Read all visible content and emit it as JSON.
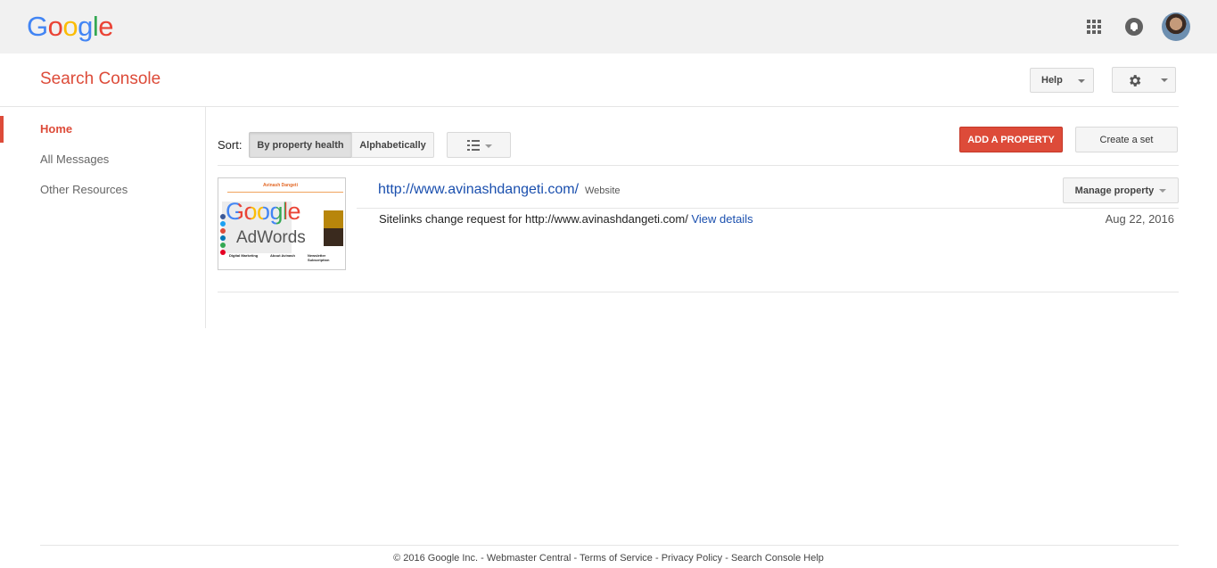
{
  "topbar": {
    "logo_letters": [
      {
        "ch": "G",
        "color": "#4285f4"
      },
      {
        "ch": "o",
        "color": "#ea4335"
      },
      {
        "ch": "o",
        "color": "#fbbc05"
      },
      {
        "ch": "g",
        "color": "#4285f4"
      },
      {
        "ch": "l",
        "color": "#34a853"
      },
      {
        "ch": "e",
        "color": "#ea4335"
      }
    ],
    "icons": [
      "apps-grid-icon",
      "notifications-bell-icon",
      "account-avatar"
    ]
  },
  "header": {
    "title": "Search Console",
    "help_label": "Help",
    "settings_icon": "gear-icon"
  },
  "sidebar": {
    "items": [
      {
        "label": "Home",
        "active": true
      },
      {
        "label": "All Messages",
        "active": false
      },
      {
        "label": "Other Resources",
        "active": false
      }
    ]
  },
  "toolbar": {
    "sort_label": "Sort:",
    "sort_options": [
      "By property health",
      "Alphabetically"
    ],
    "sort_selected": "By property health",
    "view_icon": "list-view-icon",
    "add_property_label": "ADD A PROPERTY",
    "create_set_label": "Create a set"
  },
  "property": {
    "url": "http://www.avinashdangeti.com/",
    "type": "Website",
    "manage_label": "Manage property",
    "thumbnail": {
      "header_text": "Avinash Dangeti",
      "google_text": "Google",
      "adwords_text": "AdWords",
      "footer_items": [
        "Digital Marketing",
        "About Avinash",
        "Newsletter Subscription"
      ]
    },
    "message": {
      "text": "Sitelinks change request for http://www.avinashdangeti.com/",
      "link_label": "View details",
      "date": "Aug 22, 2016"
    }
  },
  "footer": {
    "copyright": "© 2016 Google Inc.",
    "separator": " - ",
    "links": [
      "Webmaster Central",
      "Terms of Service",
      "Privacy Policy",
      "Search Console Help"
    ]
  },
  "colors": {
    "brand_red": "#dd4b39",
    "link_blue": "#1a4fae"
  }
}
